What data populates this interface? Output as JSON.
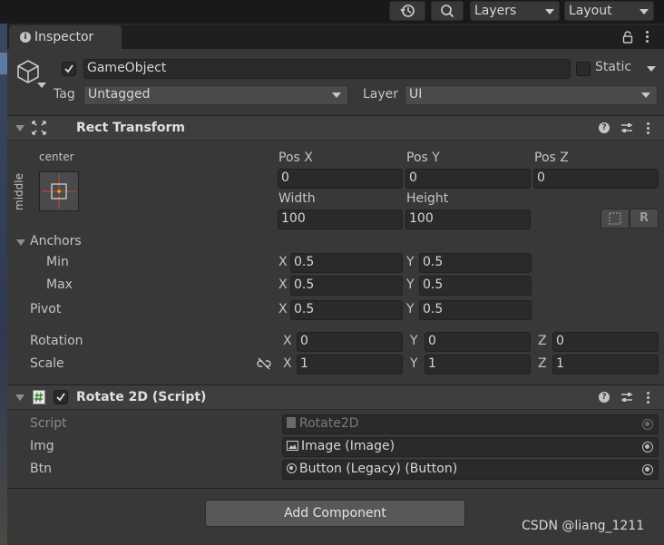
{
  "toolbar": {
    "layers_label": "Layers",
    "layout_label": "Layout",
    "history_icon": "history-icon",
    "search_icon": "search-icon"
  },
  "tab": {
    "label": "Inspector",
    "icon": "info-icon"
  },
  "gameobject": {
    "name": "GameObject",
    "static_label": "Static",
    "tag_label": "Tag",
    "tag_value": "Untagged",
    "layer_label": "Layer",
    "layer_value": "UI"
  },
  "rect_transform": {
    "title": "Rect Transform",
    "anchor_h": "center",
    "anchor_v": "middle",
    "pos_x_label": "Pos X",
    "pos_x": "0",
    "pos_y_label": "Pos Y",
    "pos_y": "0",
    "pos_z_label": "Pos Z",
    "pos_z": "0",
    "width_label": "Width",
    "width": "100",
    "height_label": "Height",
    "height": "100",
    "blueprint_btn": "R",
    "anchors_label": "Anchors",
    "min_label": "Min",
    "min_x": "0.5",
    "min_y": "0.5",
    "max_label": "Max",
    "max_x": "0.5",
    "max_y": "0.5",
    "pivot_label": "Pivot",
    "pivot_x": "0.5",
    "pivot_y": "0.5",
    "rotation_label": "Rotation",
    "rot_x": "0",
    "rot_y": "0",
    "rot_z": "0",
    "scale_label": "Scale",
    "scale_x": "1",
    "scale_y": "1",
    "scale_z": "1",
    "x": "X",
    "y": "Y",
    "z": "Z"
  },
  "script_comp": {
    "title": "Rotate 2D (Script)",
    "script_label": "Script",
    "script_value": "Rotate2D",
    "img_label": "Img",
    "img_value": "Image (Image)",
    "btn_label": "Btn",
    "btn_value": "Button (Legacy) (Button)"
  },
  "add_component_label": "Add Component",
  "watermark": "CSDN @liang_1211",
  "colors": {
    "panel": "#383838",
    "header": "#3e3e3e",
    "field": "#2a2a2a",
    "anchor_red": "#d04040",
    "anchor_yellow": "#e8b000"
  }
}
